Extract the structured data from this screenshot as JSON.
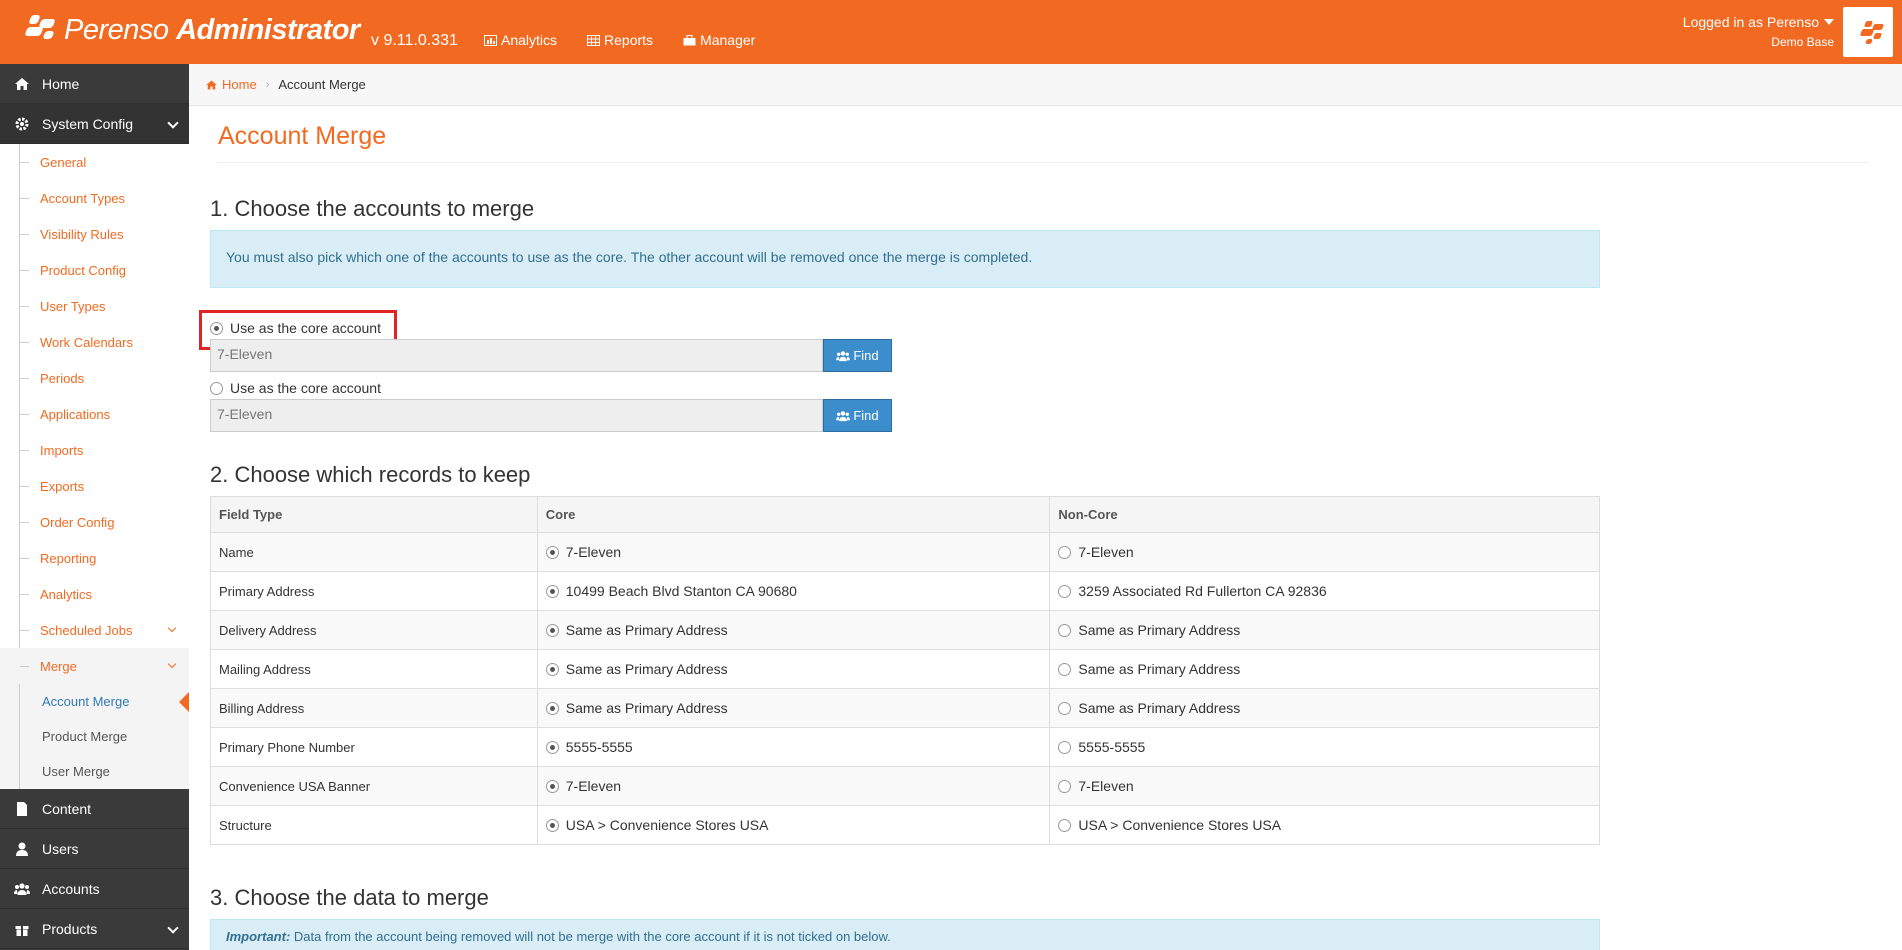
{
  "header": {
    "brand_light": "Perenso",
    "brand_bold": "Administrator",
    "version": "v 9.11.0.331",
    "nav": [
      {
        "label": "Analytics",
        "icon": "chart-icon"
      },
      {
        "label": "Reports",
        "icon": "table-icon"
      },
      {
        "label": "Manager",
        "icon": "briefcase-icon"
      }
    ],
    "user": {
      "logged_in": "Logged in as Perenso",
      "db": "Demo Base"
    }
  },
  "sidebar": {
    "home": "Home",
    "system_config": "System Config",
    "sub_items": [
      "General",
      "Account Types",
      "Visibility Rules",
      "Product Config",
      "User Types",
      "Work Calendars",
      "Periods",
      "Applications",
      "Imports",
      "Exports",
      "Order Config",
      "Reporting",
      "Analytics",
      "Scheduled Jobs",
      "Merge"
    ],
    "merge_items": [
      "Account Merge",
      "Product Merge",
      "User Merge"
    ],
    "bottom": [
      "Content",
      "Users",
      "Accounts",
      "Products"
    ]
  },
  "breadcrumb": {
    "home": "Home",
    "current": "Account Merge"
  },
  "page": {
    "title": "Account Merge",
    "section1": "1. Choose the accounts to merge",
    "info": "You must also pick which one of the accounts to use as the core. The other account will be removed once the merge is completed.",
    "core_label": "Use as the core account",
    "account1": "7-Eleven",
    "account2": "7-Eleven",
    "find": "Find",
    "section2": "2. Choose which records to keep",
    "columns": [
      "Field Type",
      "Core",
      "Non-Core"
    ],
    "rows": [
      [
        "Name",
        "7-Eleven",
        "7-Eleven"
      ],
      [
        "Primary Address",
        "10499 Beach Blvd Stanton CA 90680",
        "3259 Associated Rd Fullerton CA 92836"
      ],
      [
        "Delivery Address",
        "Same as Primary Address",
        "Same as Primary Address"
      ],
      [
        "Mailing Address",
        "Same as Primary Address",
        "Same as Primary Address"
      ],
      [
        "Billing Address",
        "Same as Primary Address",
        "Same as Primary Address"
      ],
      [
        "Primary Phone Number",
        "5555-5555",
        "5555-5555"
      ],
      [
        "Convenience USA Banner",
        "7-Eleven",
        "7-Eleven"
      ],
      [
        "Structure",
        "USA > Convenience Stores USA",
        "USA > Convenience Stores USA"
      ]
    ],
    "section3": "3. Choose the data to merge",
    "important_label": "Important:",
    "important_text": "Data from the account being removed will not be merge with the core account if it is not ticked on below."
  },
  "colors": {
    "brand": "#f26a21",
    "sidebar": "#3a3a3a",
    "primary_btn": "#3c8dcc"
  }
}
